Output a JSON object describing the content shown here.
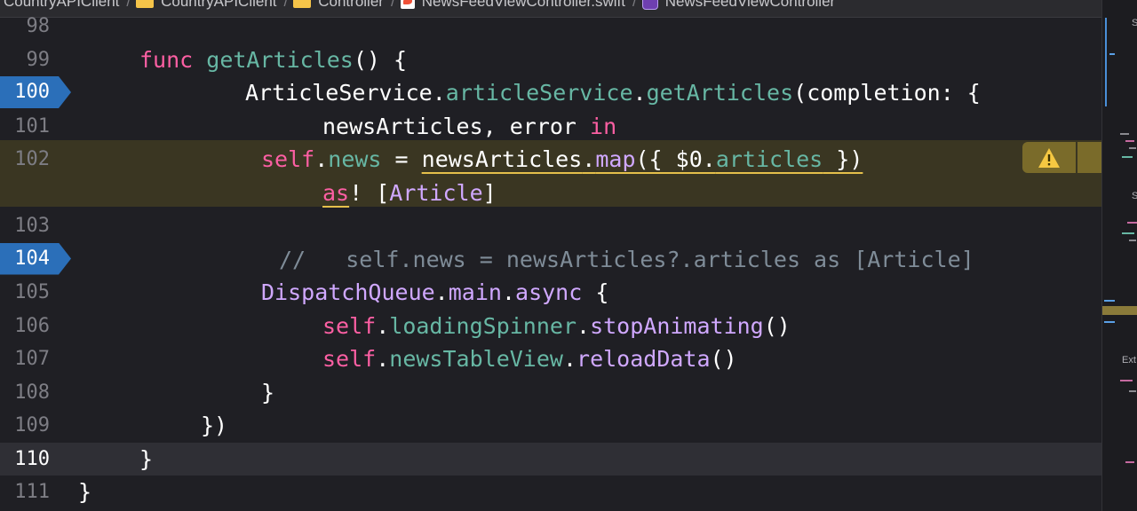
{
  "breadcrumb": [
    "CountryAPIClient",
    "CountryAPIClient",
    "Controller",
    "NewsFeedViewController.swift",
    "NewsFeedViewController"
  ],
  "lines": [
    {
      "n": "98"
    },
    {
      "n": "99",
      "parts": [
        [
          "kw",
          "func "
        ],
        [
          "fn",
          "getArticles"
        ],
        [
          "pl",
          "() {"
        ]
      ]
    },
    {
      "n": "100",
      "parts": [
        [
          "pl",
          "ArticleService."
        ],
        [
          "fn",
          "articleService"
        ],
        [
          "pl",
          "."
        ],
        [
          "fn",
          "getArticles"
        ],
        [
          "pl",
          "(completion: {"
        ]
      ]
    },
    {
      "n": "101",
      "parts": [
        [
          "pl",
          "newsArticles, error "
        ],
        [
          "kw",
          "in"
        ]
      ]
    },
    {
      "n": "102",
      "parts": [
        [
          "kw",
          "self"
        ],
        [
          "pl",
          "."
        ],
        [
          "fn",
          "news"
        ],
        [
          "pl",
          " = "
        ],
        [
          "plu",
          "newsArticles"
        ],
        [
          "plu",
          "."
        ],
        [
          "tyu",
          "map"
        ],
        [
          "plu",
          "({ $0."
        ],
        [
          "fnu",
          "articles"
        ],
        [
          "plu",
          " })"
        ]
      ]
    },
    {
      "n": "",
      "parts": [
        [
          "kwu",
          "as"
        ],
        [
          "pl",
          "! ["
        ],
        [
          "ty",
          "Article"
        ],
        [
          "pl",
          "]"
        ]
      ]
    },
    {
      "n": "103"
    },
    {
      "n": "104",
      "parts": [
        [
          "cm",
          "//   self.news = newsArticles?.articles as [Article]"
        ]
      ]
    },
    {
      "n": "105",
      "parts": [
        [
          "ty",
          "DispatchQueue"
        ],
        [
          "pl",
          "."
        ],
        [
          "ty",
          "main"
        ],
        [
          "pl",
          "."
        ],
        [
          "ty",
          "async"
        ],
        [
          "pl",
          " {"
        ]
      ]
    },
    {
      "n": "106",
      "parts": [
        [
          "kw",
          "self"
        ],
        [
          "pl",
          "."
        ],
        [
          "fn",
          "loadingSpinner"
        ],
        [
          "pl",
          "."
        ],
        [
          "ty",
          "stopAnimating"
        ],
        [
          "pl",
          "()"
        ]
      ]
    },
    {
      "n": "107",
      "parts": [
        [
          "kw",
          "self"
        ],
        [
          "pl",
          "."
        ],
        [
          "fn",
          "newsTableView"
        ],
        [
          "pl",
          "."
        ],
        [
          "ty",
          "reloadData"
        ],
        [
          "pl",
          "()"
        ]
      ]
    },
    {
      "n": "108",
      "parts": [
        [
          "pl",
          "}"
        ]
      ]
    },
    {
      "n": "109",
      "parts": [
        [
          "pl",
          "})"
        ]
      ]
    },
    {
      "n": "110",
      "parts": [
        [
          "pl",
          "}"
        ]
      ]
    },
    {
      "n": "111",
      "parts": [
        [
          "pl",
          "}"
        ]
      ]
    }
  ],
  "breakpoints": [
    "100",
    "104"
  ],
  "current_line": "110",
  "warning_line": "102",
  "minimap": {
    "labels": [
      "S",
      "S",
      "Ext"
    ]
  },
  "colors": {
    "keyword": "#fc5fa3",
    "function": "#67b7a4",
    "type": "#d0a8ff",
    "plain": "#ffffff",
    "comment": "#7f8c98",
    "breakpoint": "#2b6fb9",
    "warning": "#e5c04b"
  }
}
